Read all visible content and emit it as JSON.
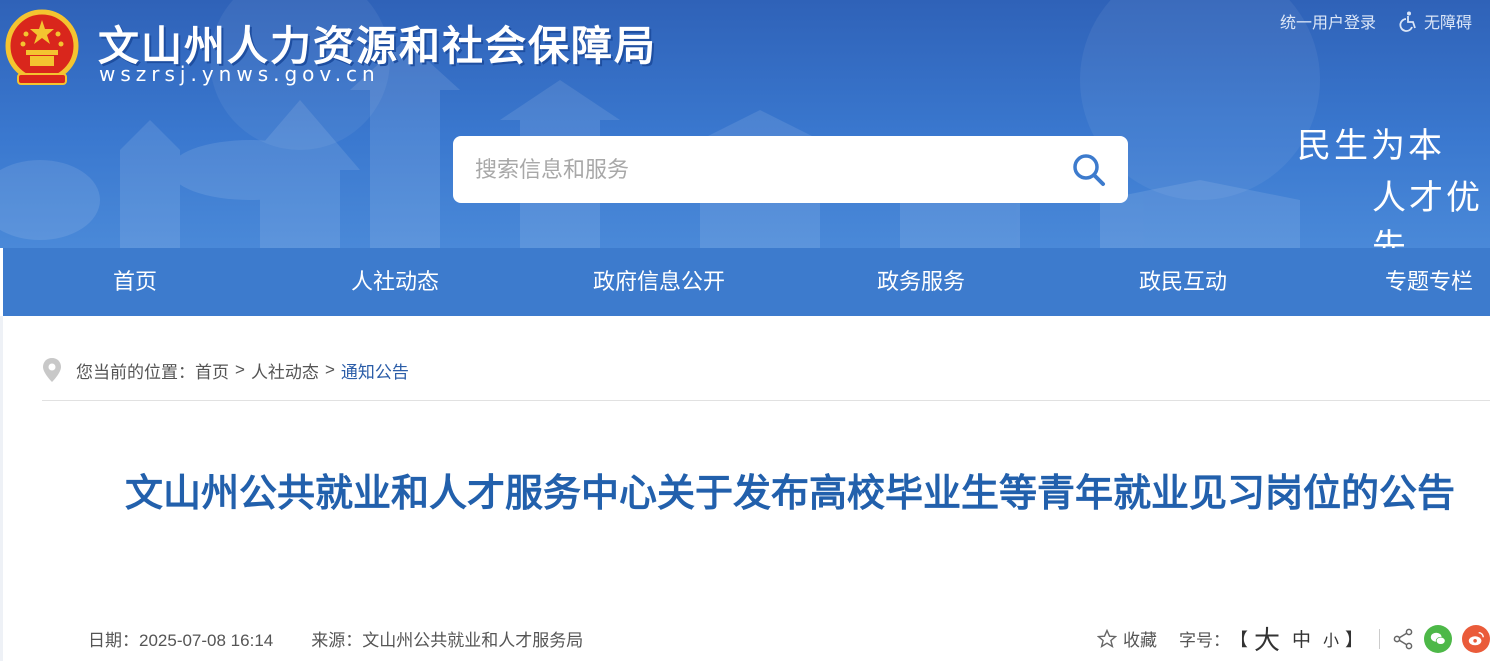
{
  "header": {
    "site_title": "文山州人力资源和社会保障局",
    "site_domain": "wszrsj.ynws.gov.cn",
    "login_label": "统一用户登录",
    "accessibility_label": "无障碍",
    "slogan_line1": "民生为本",
    "slogan_line2": "人才优先"
  },
  "search": {
    "placeholder": "搜索信息和服务"
  },
  "nav": {
    "items": [
      {
        "label": "首页"
      },
      {
        "label": "人社动态"
      },
      {
        "label": "政府信息公开"
      },
      {
        "label": "政务服务"
      },
      {
        "label": "政民互动"
      },
      {
        "label": "专题专栏"
      }
    ]
  },
  "breadcrumb": {
    "prefix": "您当前的位置：",
    "items": [
      {
        "label": "首页"
      },
      {
        "label": "人社动态"
      },
      {
        "label": "通知公告"
      }
    ],
    "separator": ">"
  },
  "article": {
    "title": "文山州公共就业和人才服务中心关于发布高校毕业生等青年就业见习岗位的公告",
    "date_label": "日期：",
    "date": "2025-07-08 16:14",
    "source_label": "来源：",
    "source": "文山州公共就业和人才服务局"
  },
  "tools": {
    "favorite_label": "收藏",
    "font_size_label": "字号：",
    "bracket_open": "【",
    "bracket_close": "】",
    "font_big": "大",
    "font_mid": "中",
    "font_small": "小"
  },
  "colors": {
    "header_blue": "#3a78cf",
    "nav_blue": "#3d7bcd",
    "title_blue": "#2260ac",
    "link_blue": "#2b5da8",
    "wechat_green": "#4db848",
    "weibo_red": "#ea5b3a"
  }
}
